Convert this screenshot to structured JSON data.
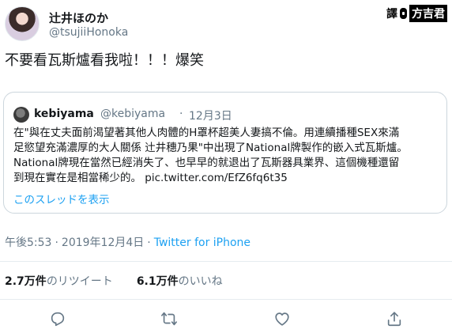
{
  "author": {
    "display_name": "辻井ほのか",
    "handle": "@tsujiiHonoka"
  },
  "watermark": {
    "text1": "譯",
    "text2": "方吉君"
  },
  "tweet": {
    "text": "不要看瓦斯爐看我啦！！！爆笑"
  },
  "quote": {
    "display_name": "kebiyama",
    "handle": "@kebiyama",
    "separator": "·",
    "date": "12月3日",
    "lines": [
      "在\"與在丈夫面前渴望著其他人肉體的H罩杯超美人妻搞不倫。用連續播種SEX來滿",
      "足慾望充滿濃厚的大人關係 辻井穗乃果\"中出現了National牌製作的嵌入式瓦斯爐。",
      "National牌現在當然已經消失了、也早早的就退出了瓦斯器具業界、這個機種還留",
      "到現在實在是相當稀少的。"
    ],
    "link": "pic.twitter.com/EfZ6fq6t35",
    "thread_label": "このスレッドを表示"
  },
  "meta": {
    "time": "午後5:53",
    "separator": "·",
    "date": "2019年12月4日",
    "separator2": "·",
    "source": "Twitter for iPhone"
  },
  "stats": {
    "retweets_count": "2.7万件",
    "retweets_label": "のリツイート",
    "likes_count": "6.1万件",
    "likes_label": "のいいね"
  },
  "icons": {
    "reply": "reply-icon",
    "retweet": "retweet-icon",
    "like": "heart-icon",
    "share": "share-icon"
  },
  "colors": {
    "link": "#1da1f2",
    "secondary": "#657786",
    "primary": "#14171a",
    "border": "#ccd6dd"
  }
}
